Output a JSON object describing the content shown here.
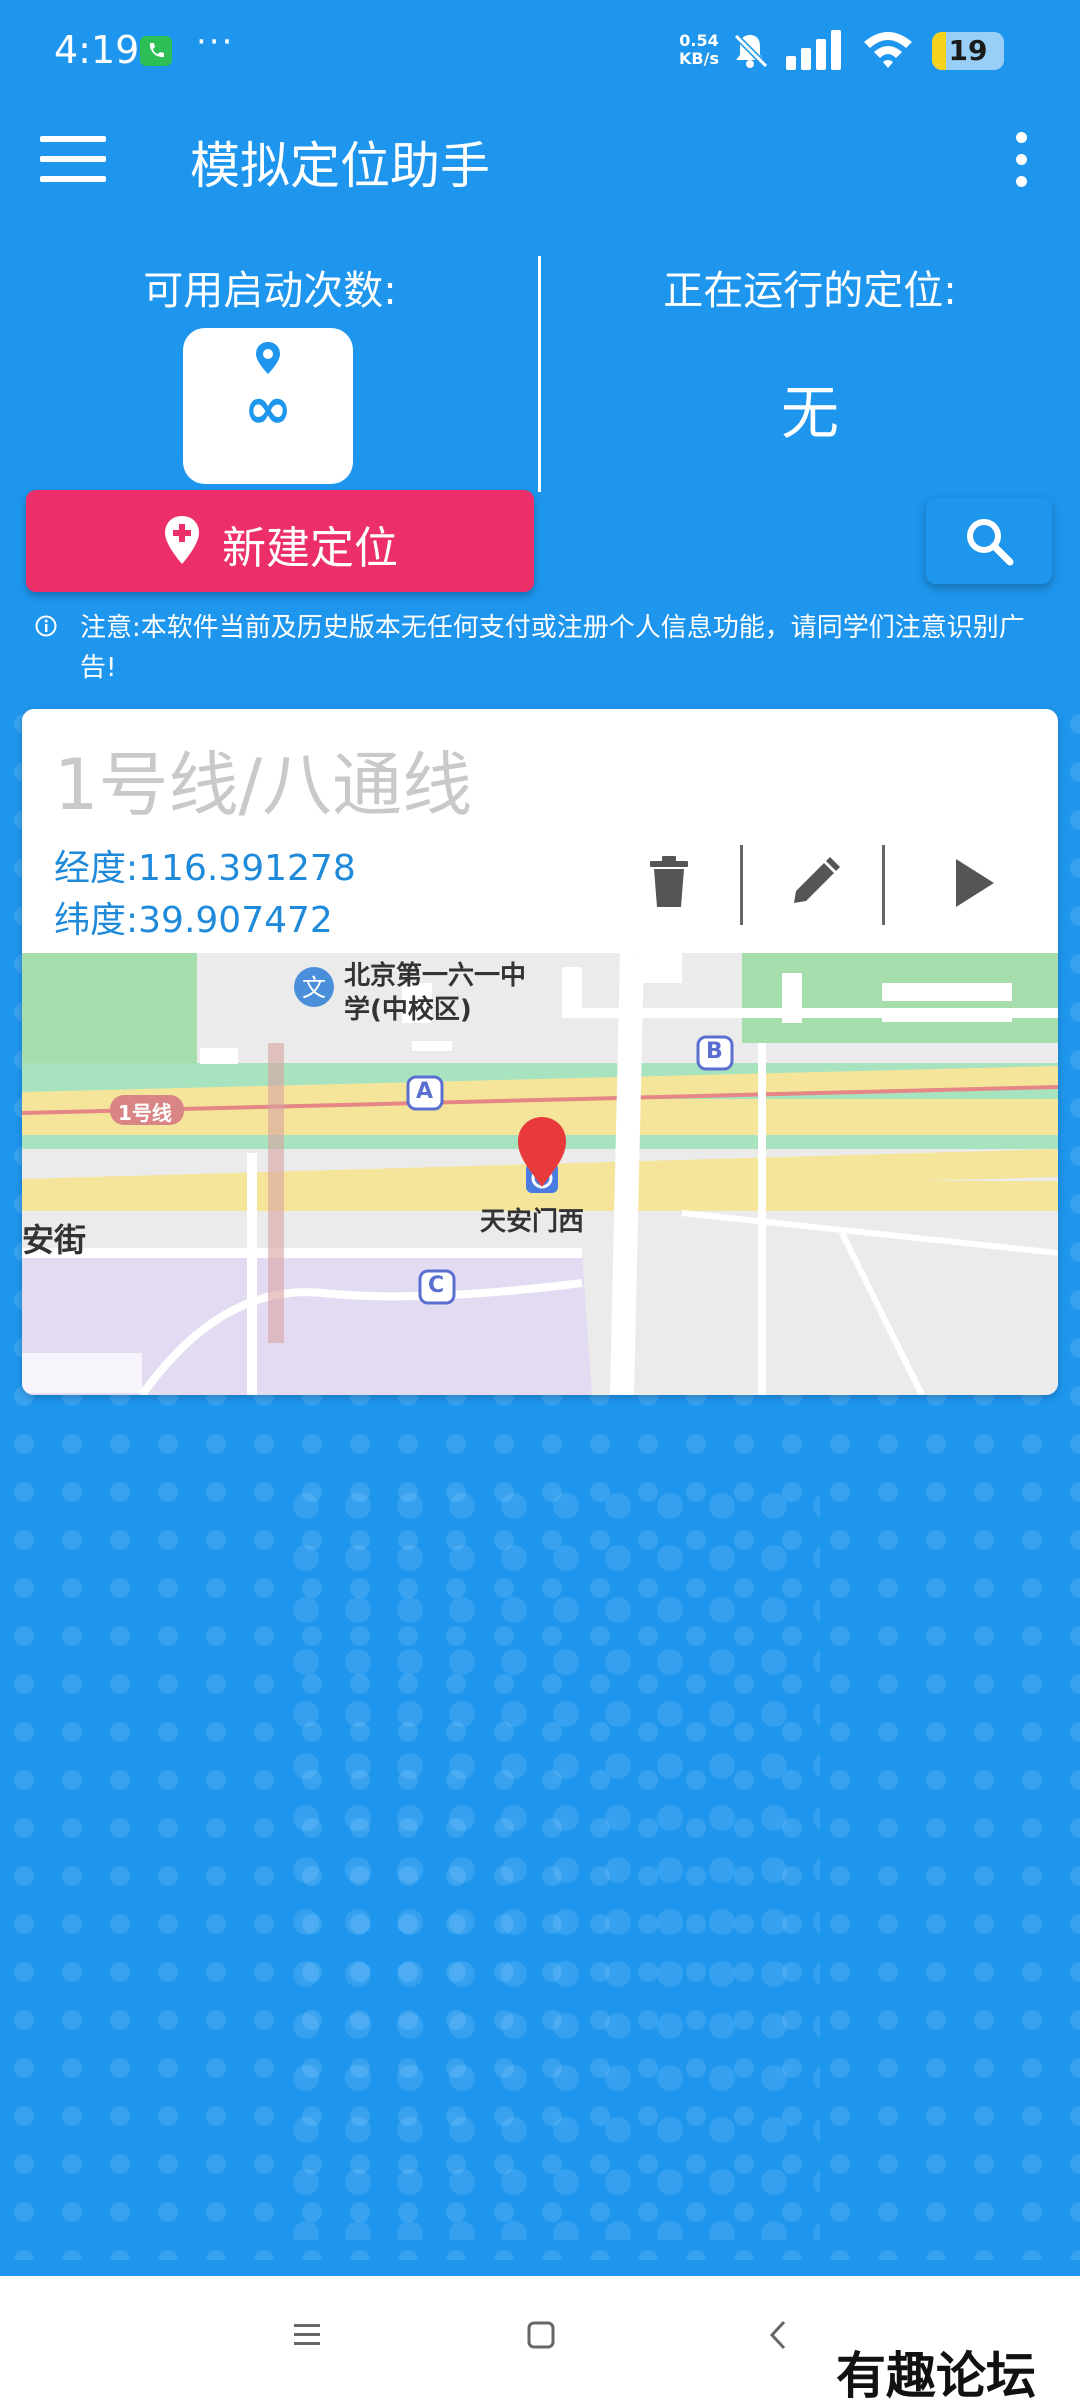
{
  "status_bar": {
    "time": "4:19",
    "more": "···",
    "net_speed_value": "0.54",
    "net_speed_unit": "KB/s",
    "battery_level": "19",
    "battery_fraction": 0.19,
    "icons": [
      "call-icon",
      "bell-off-icon",
      "signal-icon",
      "wifi-icon",
      "battery-icon"
    ]
  },
  "app_bar": {
    "title": "模拟定位助手",
    "icons": [
      "menu-icon",
      "overflow-menu-icon"
    ]
  },
  "info_panel": {
    "launches_label": "可用启动次数:",
    "launches_value": "∞",
    "running_label": "正在运行的定位:",
    "running_value": "无"
  },
  "actions": {
    "new_location_label": "新建定位",
    "search_icon": "search-icon"
  },
  "notice": "注意:本软件当前及历史版本无任何支付或注册个人信息功能，请同学们注意识别广告!",
  "location_card": {
    "name": "1号线/八通线",
    "longitude_label": "经度:",
    "longitude_value": "116.391278",
    "latitude_label": "纬度:",
    "latitude_value": "39.907472",
    "action_icons": [
      "trash-icon",
      "edit-icon",
      "play-icon"
    ],
    "map_labels": {
      "school": "北京第一六一中",
      "school_line2": "学(中校区)",
      "station": "天安门西",
      "street": "安街",
      "line_badge": "1号线",
      "exit_a": "A",
      "exit_b": "B",
      "exit_c": "C"
    }
  },
  "nav_bar": {
    "icons": [
      "recents-icon",
      "home-icon",
      "back-icon"
    ]
  },
  "watermark": "有趣论坛"
}
